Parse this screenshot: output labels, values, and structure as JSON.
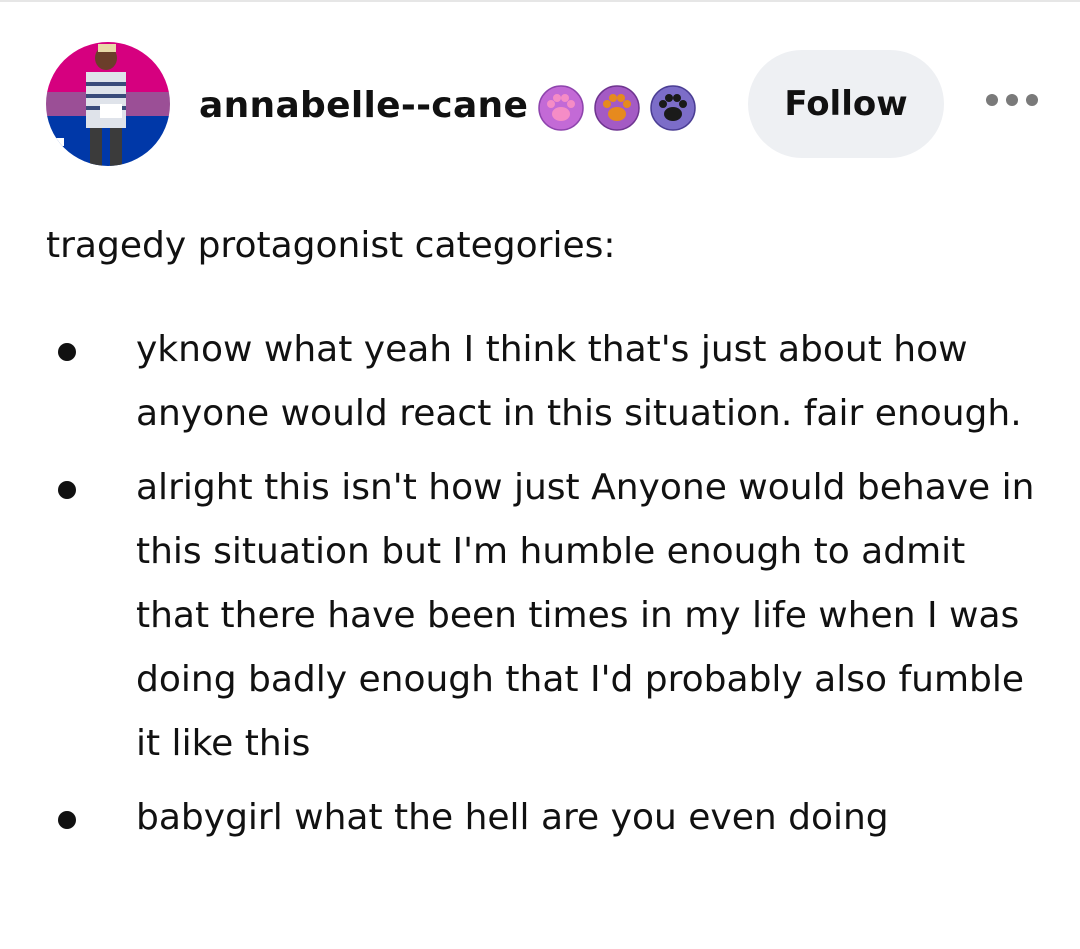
{
  "post": {
    "author": {
      "username": "annabelle--cane",
      "avatar_icon": "avatar-person-bi-flag",
      "avatar_colors": [
        "#d6007f",
        "#9b4f96",
        "#0038a8"
      ],
      "badges": [
        {
          "icon": "paw-badge-pink",
          "bg": "#c36ad6",
          "paw": "#f58cc6"
        },
        {
          "icon": "paw-badge-orange",
          "bg": "#a45ac4",
          "paw": "#e68a1e"
        },
        {
          "icon": "paw-badge-dark",
          "bg": "#7c6dc8",
          "paw": "#1a1a1a"
        }
      ]
    },
    "follow_label": "Follow",
    "more_icon": "ellipsis-icon",
    "intro": "tragedy protagonist categories:",
    "items": [
      {
        "text": "yknow what yeah I think that's just about how anyone would react in this situation. fair enough."
      },
      {
        "text": "alright this isn't how just Anyone would behave in this situation but I'm humble enough to admit that there have been times in my life when I was doing badly enough that I'd probably also fumble it like this"
      },
      {
        "text": "babygirl what the hell are you even doing"
      }
    ]
  }
}
